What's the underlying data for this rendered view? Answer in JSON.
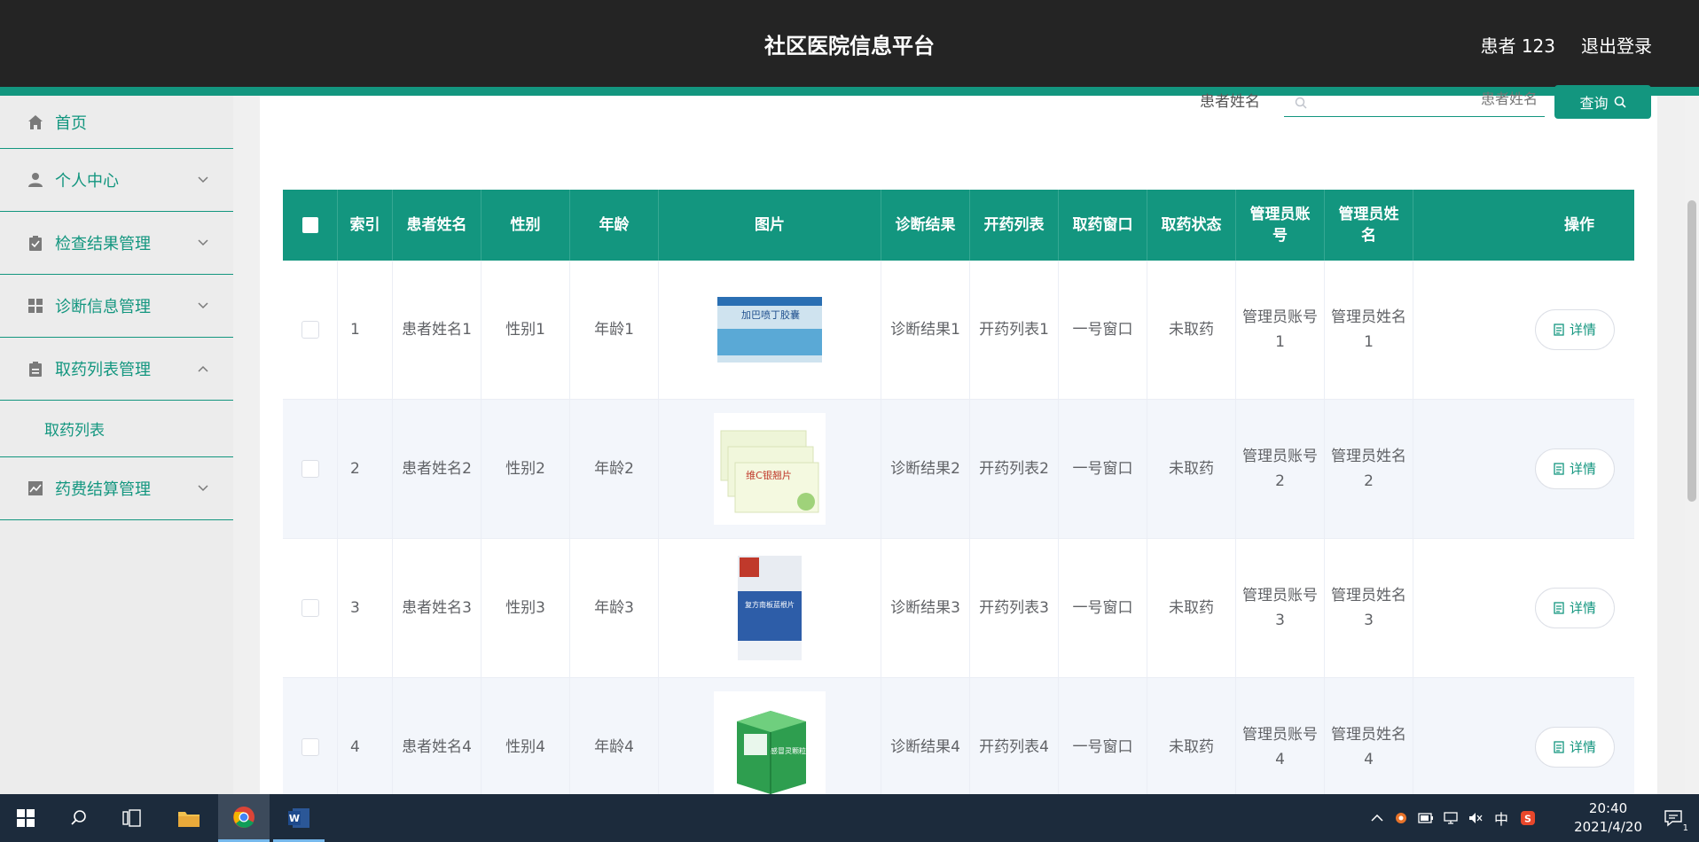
{
  "header": {
    "title": "社区医院信息平台",
    "user": "患者 123",
    "logout": "退出登录"
  },
  "sidebar": {
    "items": [
      {
        "label": "首页",
        "icon": "home-icon"
      },
      {
        "label": "个人中心",
        "icon": "user-icon"
      },
      {
        "label": "检查结果管理",
        "icon": "clipboard-icon"
      },
      {
        "label": "诊断信息管理",
        "icon": "grid-icon"
      },
      {
        "label": "取药列表管理",
        "icon": "clipboard-icon"
      },
      {
        "label": "药费结算管理",
        "icon": "chart-icon"
      }
    ],
    "submenu": {
      "label": "取药列表"
    }
  },
  "search": {
    "label": "患者姓名",
    "placeholder": "患者姓名",
    "button": "查询"
  },
  "table": {
    "headers": [
      "索引",
      "患者姓名",
      "性别",
      "年龄",
      "图片",
      "诊断结果",
      "开药列表",
      "取药窗口",
      "取药状态",
      "管理员账号",
      "管理员姓名",
      "操作"
    ],
    "rows": [
      {
        "index": "1",
        "name": "患者姓名1",
        "gender": "性别1",
        "age": "年龄1",
        "image_text": "加巴喷丁胶囊",
        "diagnosis": "诊断结果1",
        "prescription": "开药列表1",
        "window": "一号窗口",
        "status": "未取药",
        "admin_account": "管理员账号1",
        "admin_name": "管理员姓名1",
        "action": "详情"
      },
      {
        "index": "2",
        "name": "患者姓名2",
        "gender": "性别2",
        "age": "年龄2",
        "image_text": "维C银翘片",
        "diagnosis": "诊断结果2",
        "prescription": "开药列表2",
        "window": "一号窗口",
        "status": "未取药",
        "admin_account": "管理员账号2",
        "admin_name": "管理员姓名2",
        "action": "详情"
      },
      {
        "index": "3",
        "name": "患者姓名3",
        "gender": "性别3",
        "age": "年龄3",
        "image_text": "复方南板蓝根片",
        "diagnosis": "诊断结果3",
        "prescription": "开药列表3",
        "window": "一号窗口",
        "status": "未取药",
        "admin_account": "管理员账号3",
        "admin_name": "管理员姓名3",
        "action": "详情"
      },
      {
        "index": "4",
        "name": "患者姓名4",
        "gender": "性别4",
        "age": "年龄4",
        "image_text": "感冒灵颗粒",
        "diagnosis": "诊断结果4",
        "prescription": "开药列表4",
        "window": "一号窗口",
        "status": "未取药",
        "admin_account": "管理员账号4",
        "admin_name": "管理员姓名4",
        "action": "详情"
      }
    ]
  },
  "taskbar": {
    "time": "20:40",
    "date": "2021/4/20",
    "ime": "中",
    "notification_count": "1"
  },
  "colors": {
    "accent": "#13967f",
    "header_bg": "#242424",
    "taskbar_bg": "#1c2b3c"
  }
}
